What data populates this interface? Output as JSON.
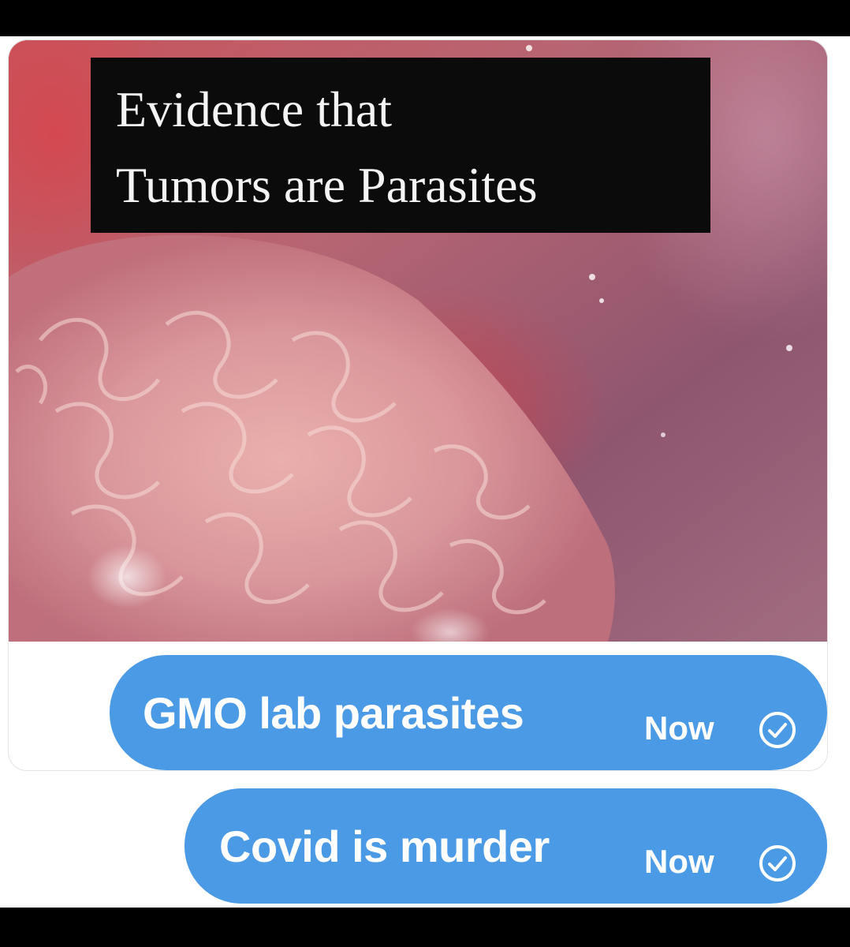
{
  "media": {
    "caption_line_1": "Evidence that",
    "caption_line_2": "Tumors are Parasites"
  },
  "messages": [
    {
      "text": "GMO lab parasites",
      "time": "Now",
      "status_icon": "check-circle-icon"
    },
    {
      "text": "Covid is murder",
      "time": "Now",
      "status_icon": "check-circle-icon"
    }
  ],
  "colors": {
    "bubble": "#4a9ae6",
    "bubble_text": "#ffffff",
    "caption_bg": "#0b0b0b",
    "caption_text": "#f4f4f4",
    "frame": "#000000"
  }
}
